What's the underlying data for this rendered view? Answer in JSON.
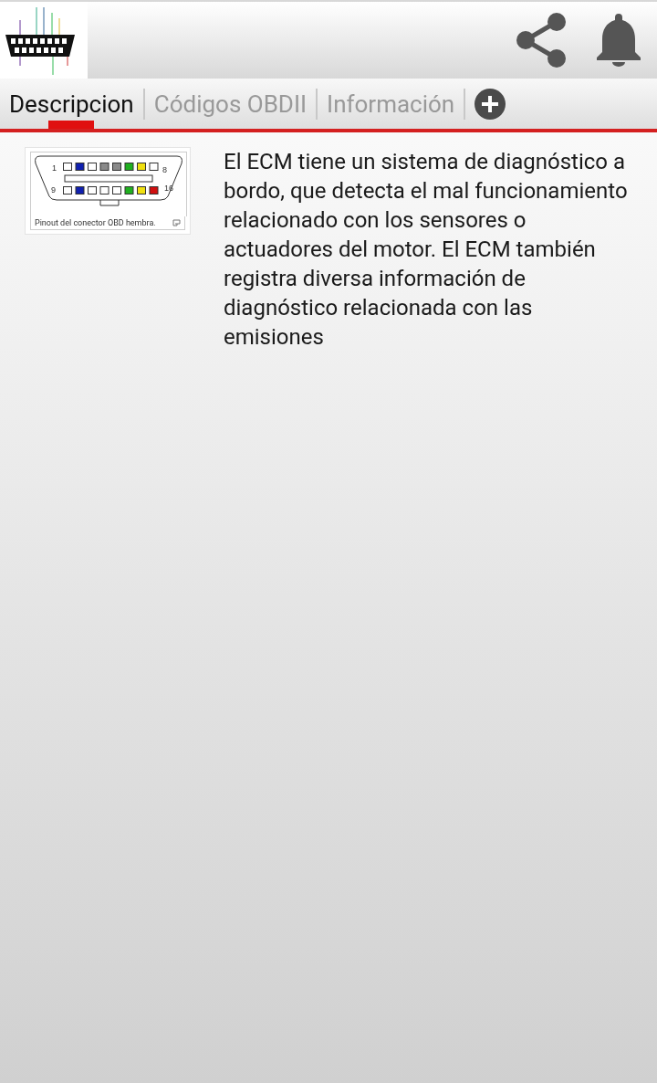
{
  "tabs": [
    {
      "label": "Descripcion",
      "selected": true
    },
    {
      "label": "Códigos OBDII",
      "selected": false
    },
    {
      "label": "Información",
      "selected": false
    }
  ],
  "figure": {
    "pin_labels": [
      "1",
      "8",
      "9",
      "16"
    ],
    "top_pins": [
      {
        "color": "#ffffff"
      },
      {
        "color": "#1020b0"
      },
      {
        "color": "#ffffff"
      },
      {
        "color": "#8a8a8a"
      },
      {
        "color": "#8a8a8a"
      },
      {
        "color": "#20b020"
      },
      {
        "color": "#f0e010"
      },
      {
        "color": "#ffffff"
      }
    ],
    "bottom_pins": [
      {
        "color": "#ffffff"
      },
      {
        "color": "#1020b0"
      },
      {
        "color": "#ffffff"
      },
      {
        "color": "#ffffff"
      },
      {
        "color": "#ffffff"
      },
      {
        "color": "#20b020"
      },
      {
        "color": "#f0e010"
      },
      {
        "color": "#d01010"
      }
    ],
    "caption": "Pinout del conector OBD hembra."
  },
  "description": "El ECM tiene un sistema de diagnóstico a bordo, que detecta el mal funcionamiento relacionado con los sensores o actuadores del motor. El ECM también registra diversa información de diagnóstico relacionada con las emisiones"
}
